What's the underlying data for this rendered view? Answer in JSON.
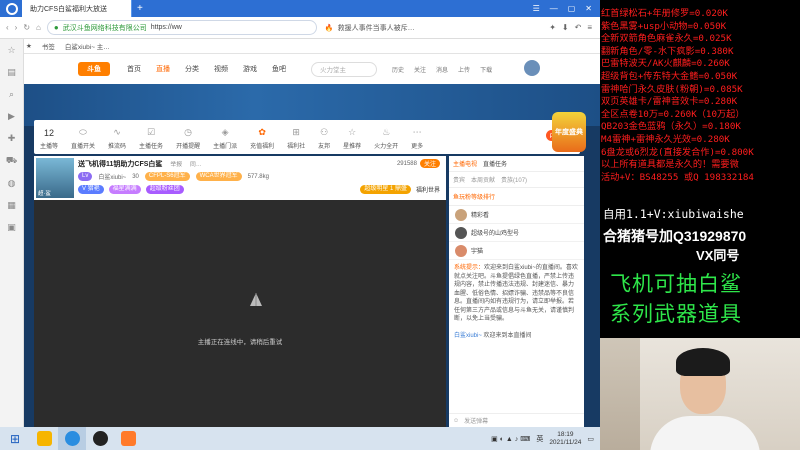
{
  "browser": {
    "tab_active": "助力CFS白鲨福利大放送",
    "url_secure_label": "武汉斗鱼网络科技有限公司",
    "url_text": "https://ww",
    "news_text": "救援人事件当事人被斥…",
    "bookmark_label": "书签",
    "bookmark_item": "白鲨xiubi~ 主…"
  },
  "site": {
    "logo_text": "斗鱼",
    "nav": [
      "首页",
      "直播",
      "分类",
      "视频",
      "游戏",
      "鱼吧"
    ],
    "active_nav": "直播",
    "search_placeholder": "火力堂主",
    "top_icons": [
      "历史",
      "关注",
      "消息",
      "上传",
      "下载"
    ]
  },
  "toolbar": {
    "level": "12",
    "items": [
      "主播等",
      "直播开关",
      "推流码",
      "主播任务",
      "开播提醒",
      "主播门派",
      "充值福利",
      "福利社",
      "友邦",
      "星推荐",
      "火力全开",
      "更多"
    ],
    "pk_label": "PC主播"
  },
  "gift_banner": "年度盛典",
  "room": {
    "title": "送飞机得11钥助力CFS白鲨",
    "report": "举报",
    "share": "同…",
    "anchor": "白鲨xiubi~",
    "heat": "30",
    "tag1": "CFPL-S6冠军",
    "tag2": "WCA世界冠军",
    "level_badge": "V 猎艳",
    "badge_a": "福星满满",
    "badge_b": "超级粉丝团",
    "weight": "577.8kg",
    "follow_count": "291588",
    "follow_label": "关注",
    "rank_badge": "超级明星 1 鼎盛",
    "fans_label": "福利世界",
    "thumb_caption": "超·鲨"
  },
  "player": {
    "message": "主播正在连线中，请稍后重试"
  },
  "chat": {
    "tabs": [
      "主播电视",
      "直播任务"
    ],
    "subtabs": [
      "贵宾",
      "本周贡献",
      "本周贡献",
      "贵族(107)"
    ],
    "rank_label": "鱼玩粉等级排行",
    "fans": [
      "精彩看",
      "超级号的山鸡型号",
      "宇猫"
    ],
    "notice_title": "系统提示：",
    "notice_body": "欢迎来到白鲨xiubi~的直播间。喜欢就点关注吧。斗鱼提倡绿色直播，严禁上传违规内容，禁止传播违法违规、封建迷信、暴力血腥、低俗色情、招嫖诈骗、违禁品等不良信息。直播间内如有违规行为，请立即举报。若任何第三方产品或信息与斗鱼无关，请谨慎判断，以免上当受骗。",
    "welcome_user": "白鲨xiubi~",
    "welcome_text": "欢迎来到本直播间",
    "input_placeholder": "发送弹幕"
  },
  "taskbar": {
    "time": "18:19",
    "date": "2021/11/24",
    "ime": "英"
  },
  "overlay": {
    "red_lines": [
      "红首绿松石+年册修罗=0.020K",
      "紫色黑雾+usp小动物=0.050K",
      "全新双箭角色麻雀永久=0.025K",
      "翻新角色/零-水下疯影=0.380K",
      "巴雷特波天/AK火麒麟=0.260K",
      "超级背包+传东特大金鳍=0.050K",
      "雷神哈门永久皮肤(粉朝)=0.085K",
      "双页英雄卡/雷神音效卡=0.280K",
      "全区点卷10万=0.260K（10万起）",
      "QB203金色蓝鸦（永久）=0.180K",
      "M4雷神+雷神永久光效=0.280K",
      "6盘龙或6烈龙(直接发合作)=0.800K",
      "以上所有道具都是永久的！需要微",
      "活动+V：BS48255  或Q 198332184"
    ],
    "white_line1": "自用1.1+V:xiubiwaishe",
    "white_line2": "合猪猪号加Q31929870",
    "white_line3": "VX同号",
    "green_line1": "飞机可抽白鲨",
    "green_line2": "系列武器道具"
  },
  "colors": {
    "accent": "#ff6600",
    "overlay_red": "#ff1e1e",
    "overlay_green": "#2ee64a",
    "browser_blue": "#2d6fd3"
  }
}
